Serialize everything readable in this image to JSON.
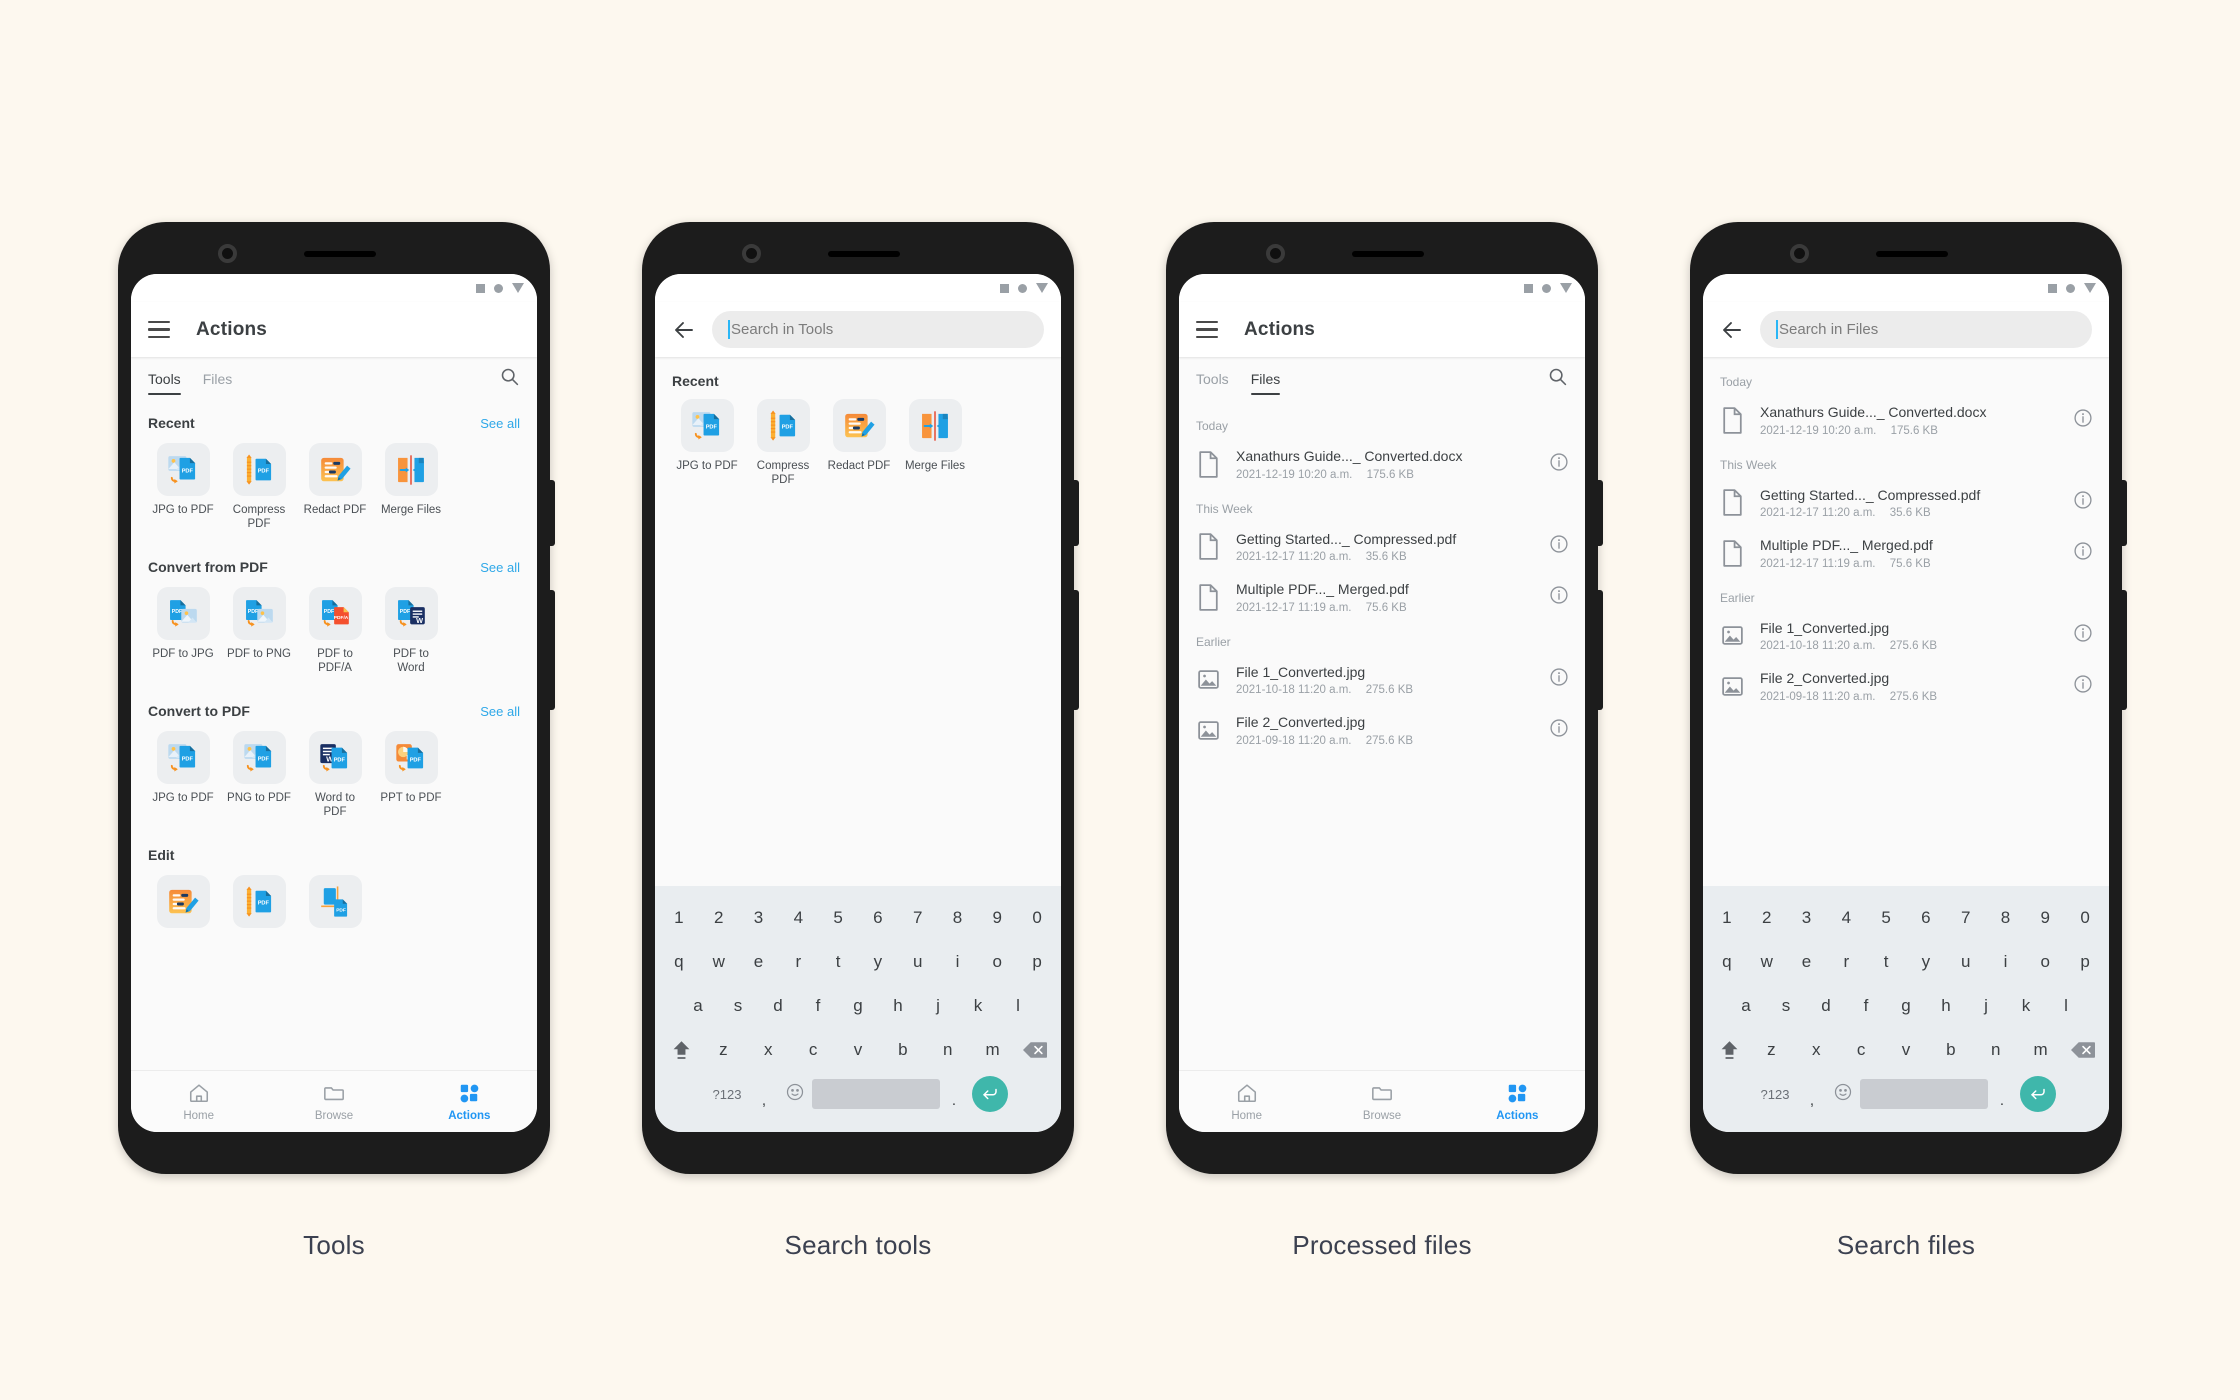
{
  "page": {
    "background_color": "#fdf8ef",
    "accent_blue": "#2196f3",
    "link_blue": "#2fa8e8",
    "enter_key_color": "#3fb7ab"
  },
  "captions": [
    "Tools",
    "Search tools",
    "Processed files",
    "Search files"
  ],
  "status_bar": {
    "icons": [
      "square-icon",
      "circle-icon",
      "triangle-down-icon"
    ]
  },
  "screen1": {
    "appbar": {
      "menu_icon": "hamburger-menu-icon",
      "title": "Actions"
    },
    "tabs": [
      {
        "label": "Tools",
        "active": true
      },
      {
        "label": "Files",
        "active": false
      }
    ],
    "search_icon": "search-icon",
    "sections": [
      {
        "title": "Recent",
        "see_all": "See all",
        "tools": [
          {
            "label": "JPG to PDF",
            "icon": "jpg-to-pdf-icon"
          },
          {
            "label": "Compress PDF",
            "icon": "compress-pdf-icon"
          },
          {
            "label": "Redact PDF",
            "icon": "redact-pdf-icon"
          },
          {
            "label": "Merge Files",
            "icon": "merge-files-icon"
          }
        ]
      },
      {
        "title": "Convert from PDF",
        "see_all": "See all",
        "tools": [
          {
            "label": "PDF to JPG",
            "icon": "pdf-to-jpg-icon"
          },
          {
            "label": "PDF to PNG",
            "icon": "pdf-to-png-icon"
          },
          {
            "label": "PDF to PDF/A",
            "icon": "pdf-to-pdfa-icon"
          },
          {
            "label": "PDF to Word",
            "icon": "pdf-to-word-icon"
          }
        ]
      },
      {
        "title": "Convert to PDF",
        "see_all": "See all",
        "tools": [
          {
            "label": "JPG to PDF",
            "icon": "jpg-to-pdf-icon"
          },
          {
            "label": "PNG to PDF",
            "icon": "png-to-pdf-icon"
          },
          {
            "label": "Word to PDF",
            "icon": "word-to-pdf-icon"
          },
          {
            "label": "PPT to PDF",
            "icon": "ppt-to-pdf-icon"
          }
        ]
      },
      {
        "title": "Edit",
        "see_all": "",
        "tools": [
          {
            "label": "",
            "icon": "redact-pdf-icon"
          },
          {
            "label": "",
            "icon": "compress-pdf-icon"
          },
          {
            "label": "",
            "icon": "organize-pages-icon"
          }
        ]
      }
    ],
    "bottom_nav": [
      {
        "label": "Home",
        "icon": "home-icon",
        "active": false
      },
      {
        "label": "Browse",
        "icon": "folder-icon",
        "active": false
      },
      {
        "label": "Actions",
        "icon": "grid-icon",
        "active": true
      }
    ]
  },
  "screen2": {
    "appbar": {
      "back_icon": "back-arrow-icon",
      "search_placeholder": "Search in Tools",
      "search_value": ""
    },
    "recent_title": "Recent",
    "recent_tools": [
      {
        "label": "JPG to PDF",
        "icon": "jpg-to-pdf-icon"
      },
      {
        "label": "Compress PDF",
        "icon": "compress-pdf-icon"
      },
      {
        "label": "Redact PDF",
        "icon": "redact-pdf-icon"
      },
      {
        "label": "Merge Files",
        "icon": "merge-files-icon"
      }
    ]
  },
  "screen3": {
    "appbar": {
      "menu_icon": "hamburger-menu-icon",
      "title": "Actions"
    },
    "tabs": [
      {
        "label": "Tools",
        "active": false
      },
      {
        "label": "Files",
        "active": true
      }
    ],
    "search_icon": "search-icon",
    "groups": [
      {
        "label": "Today",
        "files": [
          {
            "name": "Xanathurs Guide..._ Converted.docx",
            "date": "2021-12-19 10:20 a.m.",
            "size": "175.6 KB",
            "icon": "document-icon"
          }
        ]
      },
      {
        "label": "This Week",
        "files": [
          {
            "name": "Getting Started..._ Compressed.pdf",
            "date": "2021-12-17 11:20 a.m.",
            "size": "35.6 KB",
            "icon": "document-icon"
          },
          {
            "name": "Multiple PDF..._ Merged.pdf",
            "date": "2021-12-17 11:19 a.m.",
            "size": "75.6 KB",
            "icon": "document-icon"
          }
        ]
      },
      {
        "label": "Earlier",
        "files": [
          {
            "name": "File 1_Converted.jpg",
            "date": "2021-10-18 11:20 a.m.",
            "size": "275.6 KB",
            "icon": "image-icon"
          },
          {
            "name": "File 2_Converted.jpg",
            "date": "2021-09-18 11:20 a.m.",
            "size": "275.6 KB",
            "icon": "image-icon"
          }
        ]
      }
    ],
    "bottom_nav": [
      {
        "label": "Home",
        "icon": "home-icon",
        "active": false
      },
      {
        "label": "Browse",
        "icon": "folder-icon",
        "active": false
      },
      {
        "label": "Actions",
        "icon": "grid-icon",
        "active": true
      }
    ]
  },
  "screen4": {
    "appbar": {
      "back_icon": "back-arrow-icon",
      "search_placeholder": "Search in Files",
      "search_value": ""
    },
    "groups": [
      {
        "label": "Today",
        "files": [
          {
            "name": "Xanathurs Guide..._ Converted.docx",
            "date": "2021-12-19 10:20 a.m.",
            "size": "175.6 KB",
            "icon": "document-icon"
          }
        ]
      },
      {
        "label": "This Week",
        "files": [
          {
            "name": "Getting Started..._ Compressed.pdf",
            "date": "2021-12-17 11:20 a.m.",
            "size": "35.6 KB",
            "icon": "document-icon"
          },
          {
            "name": "Multiple PDF..._ Merged.pdf",
            "date": "2021-12-17 11:19 a.m.",
            "size": "75.6 KB",
            "icon": "document-icon"
          }
        ]
      },
      {
        "label": "Earlier",
        "files": [
          {
            "name": "File 1_Converted.jpg",
            "date": "2021-10-18 11:20 a.m.",
            "size": "275.6 KB",
            "icon": "image-icon"
          },
          {
            "name": "File 2_Converted.jpg",
            "date": "2021-09-18 11:20 a.m.",
            "size": "275.6 KB",
            "icon": "image-icon"
          }
        ]
      }
    ]
  },
  "keyboard": {
    "row1": [
      "1",
      "2",
      "3",
      "4",
      "5",
      "6",
      "7",
      "8",
      "9",
      "0"
    ],
    "row2": [
      "q",
      "w",
      "e",
      "r",
      "t",
      "y",
      "u",
      "i",
      "o",
      "p"
    ],
    "row3": [
      "a",
      "s",
      "d",
      "f",
      "g",
      "h",
      "j",
      "k",
      "l"
    ],
    "row4": [
      "z",
      "x",
      "c",
      "v",
      "b",
      "n",
      "m"
    ],
    "shift": "shift-icon",
    "delete": "backspace-icon",
    "symbols": "?123",
    "comma": ",",
    "emoji": "emoji-icon",
    "space": "",
    "period": ".",
    "enter": "enter-icon"
  }
}
